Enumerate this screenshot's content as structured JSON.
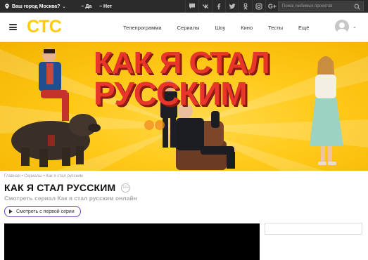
{
  "topbar": {
    "city_label": "Ваш город Москва?",
    "confirm_yes": "– Да",
    "confirm_no": "– Нет",
    "social_icons": [
      "chat-icon",
      "vk-icon",
      "facebook-icon",
      "twitter-icon",
      "odnoklassniki-icon",
      "instagram-icon",
      "google-plus-icon"
    ],
    "google_label": "G+",
    "search_placeholder": "Поиск любимых проектов"
  },
  "header": {
    "logo": "СТС",
    "logo_color": "#ffcb05",
    "nav": [
      "Телепрограмма",
      "Сериалы",
      "Шоу",
      "Кино",
      "Тесты",
      "Ещё"
    ]
  },
  "banner": {
    "title_line1": "КАК Я СТАЛ",
    "title_line2": "РУССКИМ",
    "title_color": "#e8362a"
  },
  "info": {
    "breadcrumb": "Главная • Сериалы • Как я стал русским",
    "title": "КАК Я СТАЛ РУССКИМ",
    "age_rating": "16+",
    "subtitle": "Смотреть сериал Как я стал русским онлайн",
    "watch_button": "Смотреть с первой серии",
    "accent_color": "#6a3fb5"
  }
}
